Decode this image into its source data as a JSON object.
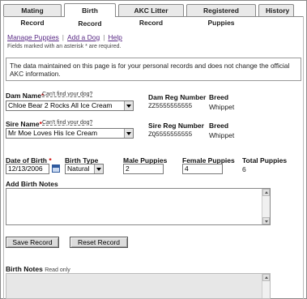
{
  "tabs": [
    {
      "label": "Mating Record"
    },
    {
      "label": "Birth Record"
    },
    {
      "label": "AKC Litter Record"
    },
    {
      "label": "Registered Puppies"
    },
    {
      "label": "History"
    }
  ],
  "links": {
    "manage": "Manage Puppies",
    "add": "Add a Dog",
    "help": "Help",
    "sep": "|"
  },
  "required_note": "Fields marked with an asterisk * are required.",
  "info": "The data maintained on this page is for your personal records and does not change the official AKC information.",
  "dam": {
    "label": "Dam Name",
    "req": "*",
    "cant_find": "Can't find your dog?",
    "value": "Chloe Bear 2 Rocks All Ice Cream",
    "reg_label": "Dam Reg Number",
    "reg_value": "ZZ5555555555",
    "breed_label": "Breed",
    "breed_value": "Whippet"
  },
  "sire": {
    "label": "Sire Name",
    "req": "*",
    "cant_find": "Can't find your dog?",
    "value": "Mr Moe Loves His Ice Cream",
    "reg_label": "Sire Reg Number",
    "reg_value": "ZQ5555555555",
    "breed_label": "Breed",
    "breed_value": "Whippet"
  },
  "birth": {
    "dob_label": "Date of Birth",
    "dob_req": "*",
    "dob_value": "12/13/2006",
    "type_label": "Birth Type",
    "type_value": "Natural",
    "male_label": "Male Puppies",
    "male_value": "2",
    "female_label": "Female Puppies",
    "female_value": "4",
    "total_label": "Total Puppies",
    "total_value": "6"
  },
  "add_notes_label": "Add Birth Notes",
  "buttons": {
    "save": "Save Record",
    "reset": "Reset Record"
  },
  "notes": {
    "label": "Birth Notes",
    "readonly": "Read only"
  }
}
